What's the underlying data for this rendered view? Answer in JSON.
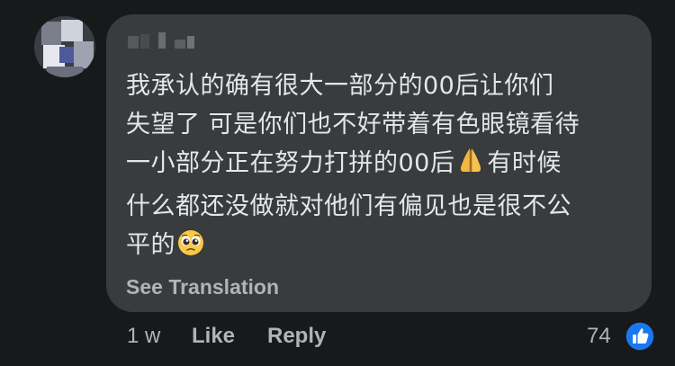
{
  "comment": {
    "lines": [
      "我承认的确有很大一部分的00后让你们",
      "失望了 可是你们也不好带着有色眼镜看待",
      "一小部分正在努力打拼的00后",
      "有时候",
      "什么都还没做就对他们有偏见也是很不公",
      "平的"
    ],
    "emoji_after_line3": "folded-hands",
    "emoji_after_line6": "pleading-face",
    "see_translation": "See Translation"
  },
  "actions": {
    "time": "1 w",
    "like": "Like",
    "reply": "Reply"
  },
  "reactions": {
    "count": "74",
    "type": "like"
  },
  "colors": {
    "background": "#18191a",
    "bubble": "#3a3b3c",
    "text": "#e4e6eb",
    "secondary": "#b0b3b8",
    "like_blue": "#1877f2"
  }
}
